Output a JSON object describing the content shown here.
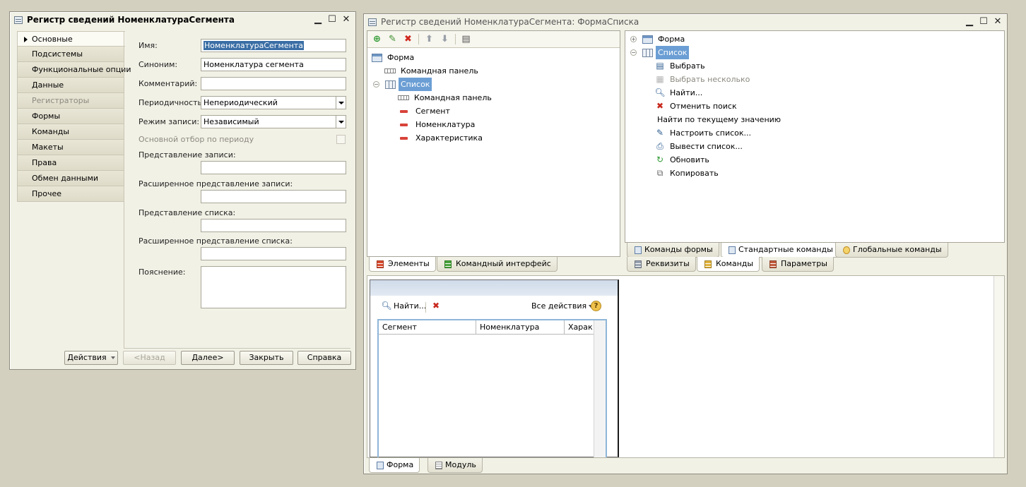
{
  "left_window": {
    "title": "Регистр сведений НоменклатураСегмента",
    "nav": [
      "Основные",
      "Подсистемы",
      "Функциональные опции",
      "Данные",
      "Регистраторы",
      "Формы",
      "Команды",
      "Макеты",
      "Права",
      "Обмен данными",
      "Прочее"
    ],
    "fields": {
      "name_label": "Имя:",
      "name_value": "НоменклатураСегмента",
      "synonym_label": "Синоним:",
      "synonym_value": "Номенклатура сегмента",
      "comment_label": "Комментарий:",
      "comment_value": "",
      "periodicity_label": "Периодичность:",
      "periodicity_value": "Непериодический",
      "write_mode_label": "Режим записи:",
      "write_mode_value": "Независимый",
      "period_filter_label": "Основной отбор по периоду",
      "record_repr_label": "Представление записи:",
      "ext_record_repr_label": "Расширенное представление записи:",
      "list_repr_label": "Представление списка:",
      "ext_list_repr_label": "Расширенное представление списка:",
      "explanation_label": "Пояснение:"
    },
    "buttons": {
      "actions": "Действия",
      "back": "<Назад",
      "next": "Далее>",
      "close": "Закрыть",
      "help": "Справка"
    }
  },
  "right_window": {
    "title": "Регистр сведений НоменклатураСегмента: ФормаСписка",
    "elements_tree": {
      "form": "Форма",
      "command_bar": "Командная панель",
      "list": "Список",
      "list_command_bar": "Командная панель",
      "fields": [
        "Сегмент",
        "Номенклатура",
        "Характеристика"
      ]
    },
    "left_tabs": [
      "Элементы",
      "Командный интерфейс"
    ],
    "commands_tree": {
      "form": "Форма",
      "list": "Список",
      "items": [
        "Выбрать",
        "Выбрать несколько",
        "Найти...",
        "Отменить поиск",
        "Найти по текущему значению",
        "Настроить список...",
        "Вывести список...",
        "Обновить",
        "Копировать"
      ]
    },
    "commands_subtabs": [
      "Команды формы",
      "Стандартные команды",
      "Глобальные команды"
    ],
    "right_tabs": [
      "Реквизиты",
      "Команды",
      "Параметры"
    ],
    "preview": {
      "find": "Найти...",
      "all_actions": "Все действия",
      "columns": [
        "Сегмент",
        "Номенклатура",
        "Характ"
      ]
    },
    "bottom_tabs": [
      "Форма",
      "Модуль"
    ]
  }
}
